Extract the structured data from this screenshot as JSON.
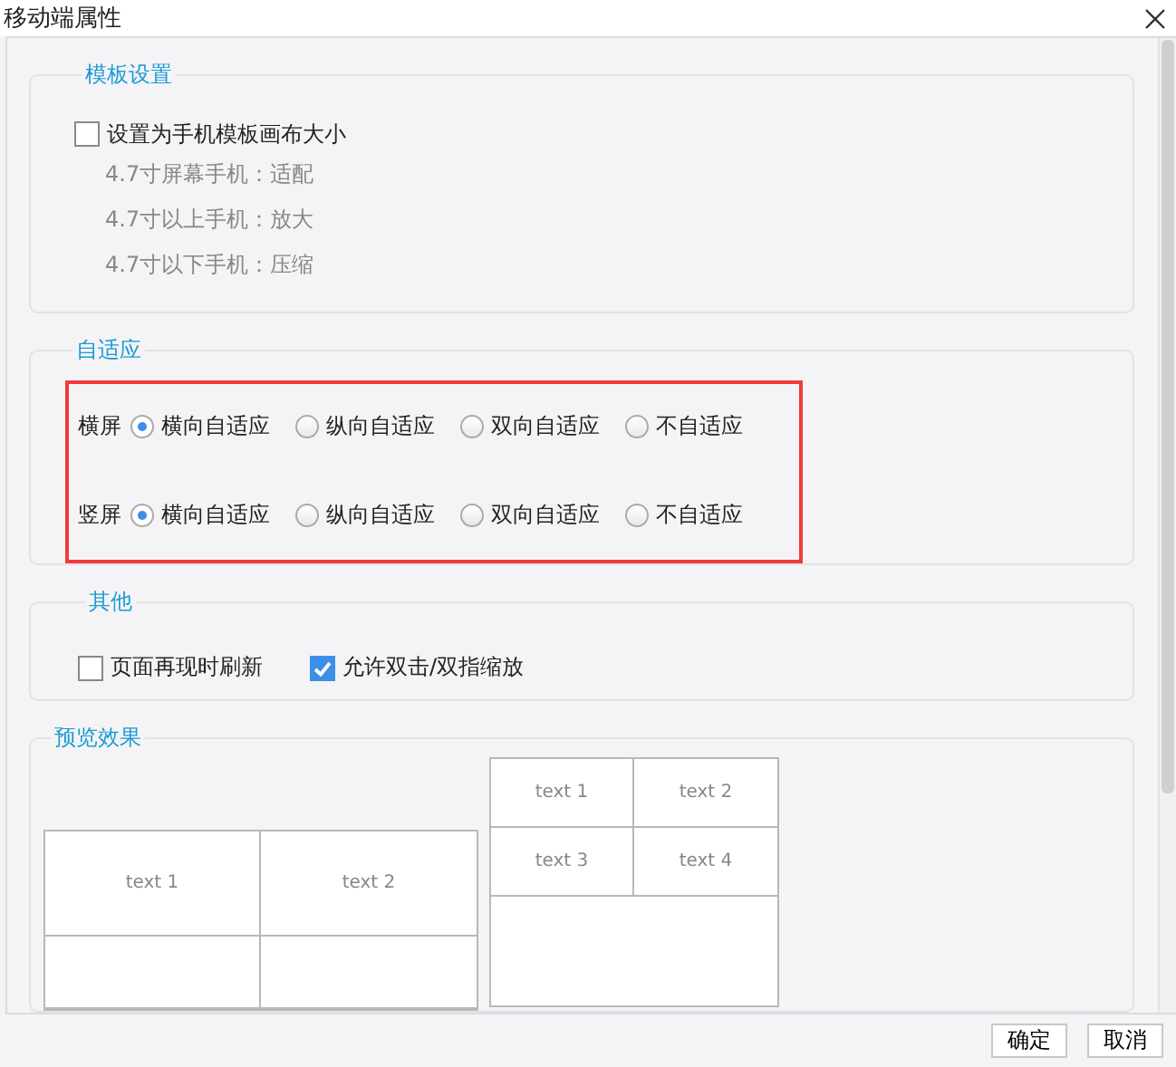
{
  "window": {
    "title": "移动端属性"
  },
  "template": {
    "legend": "模板设置",
    "checkbox": {
      "label": "设置为手机模板画布大小",
      "checked": false
    },
    "notes": [
      "4.7寸屏幕手机：适配",
      "4.7寸以上手机：放大",
      "4.7寸以下手机：压缩"
    ]
  },
  "adaptive": {
    "legend": "自适应",
    "highlighted": true,
    "rows": [
      {
        "label": "横屏",
        "options": [
          {
            "label": "横向自适应",
            "selected": true
          },
          {
            "label": "纵向自适应",
            "selected": false
          },
          {
            "label": "双向自适应",
            "selected": false
          },
          {
            "label": "不自适应",
            "selected": false
          }
        ]
      },
      {
        "label": "竖屏",
        "options": [
          {
            "label": "横向自适应",
            "selected": true
          },
          {
            "label": "纵向自适应",
            "selected": false
          },
          {
            "label": "双向自适应",
            "selected": false
          },
          {
            "label": "不自适应",
            "selected": false
          }
        ]
      }
    ]
  },
  "other": {
    "legend": "其他",
    "checkboxes": [
      {
        "label": "页面再现时刷新",
        "checked": false
      },
      {
        "label": "允许双击/双指缩放",
        "checked": true
      }
    ]
  },
  "preview": {
    "legend": "预览效果",
    "tables": [
      {
        "kind": "landscape",
        "rows": [
          [
            "text 1",
            "text 2"
          ]
        ]
      },
      {
        "kind": "portrait",
        "rows": [
          [
            "text 1",
            "text 2"
          ],
          [
            "text 3",
            "text 4"
          ]
        ]
      }
    ]
  },
  "buttons": [
    "确定",
    "取消"
  ]
}
